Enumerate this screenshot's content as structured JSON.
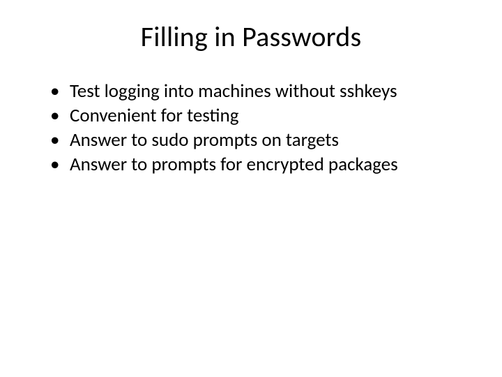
{
  "slide": {
    "title": "Filling in Passwords",
    "bullets": [
      "Test logging into machines without sshkeys",
      "Convenient for testing",
      "Answer to sudo prompts on targets",
      "Answer to prompts for encrypted packages"
    ]
  }
}
